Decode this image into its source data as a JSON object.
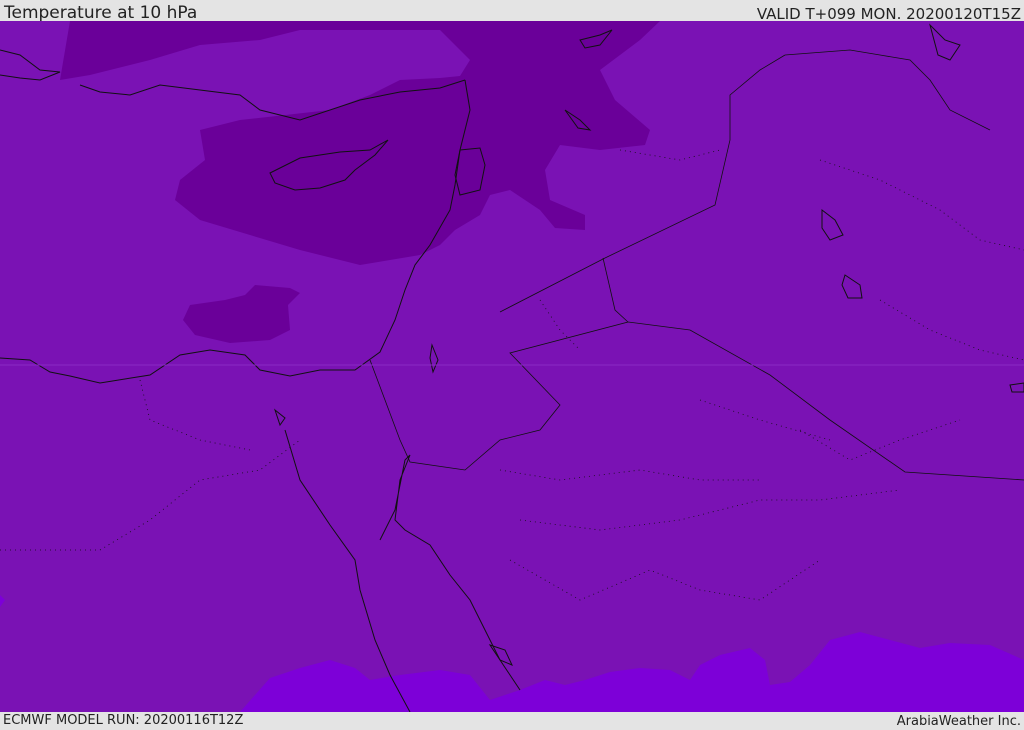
{
  "header": {
    "title": "Temperature at 10 hPa",
    "valid_time": "VALID T+099 MON. 20200120T15Z"
  },
  "footer": {
    "model_run": "ECMWF MODEL RUN: 20200116T12Z",
    "credit": "ArabiaWeather Inc."
  },
  "colors": {
    "background_field": "#7a12b4",
    "cold_field": "#6a0099",
    "warm_field": "#7d00d8",
    "coastline": "#111111",
    "frame": "#e4e4e4"
  }
}
